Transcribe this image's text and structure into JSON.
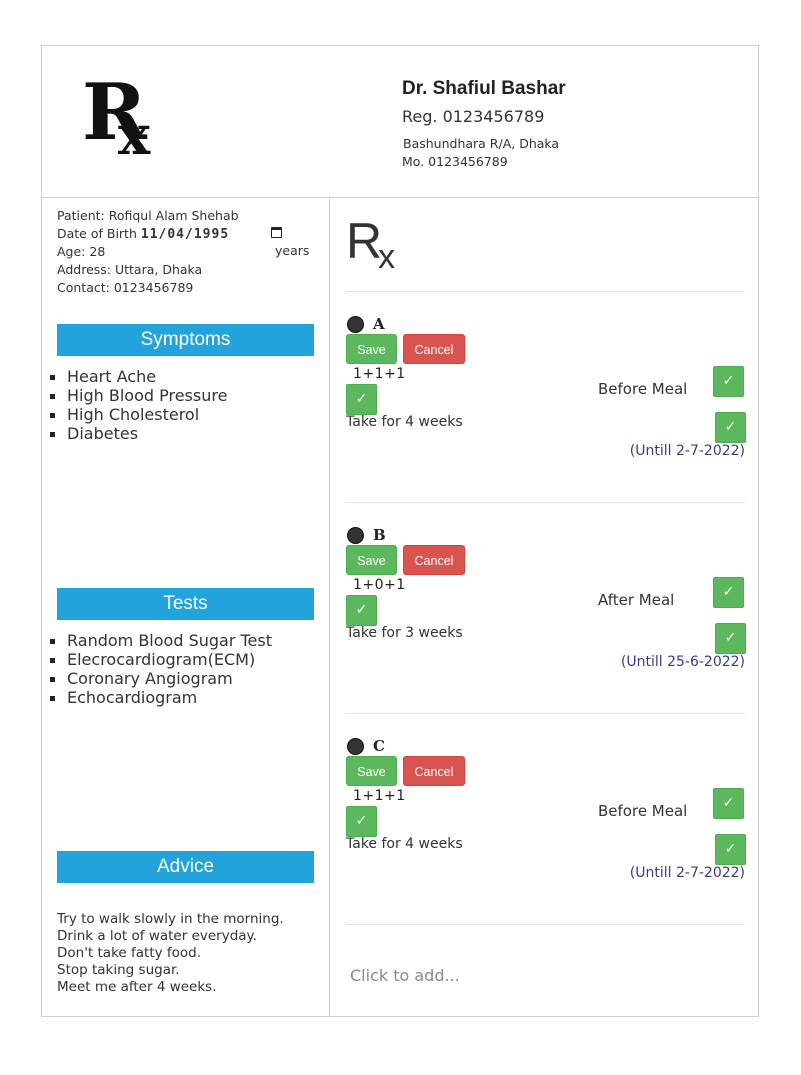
{
  "doctor": {
    "name": "Dr.  Shafiul Bashar",
    "reg": "Reg.  0123456789",
    "address": "Bashundhara R/A, Dhaka",
    "mobile": "Mo.  0123456789"
  },
  "logo": {
    "big": "R",
    "sub": "x"
  },
  "patient": {
    "name_line": "Patient:  Rofiqul Alam Shehab",
    "dob_label": "Date of Birth",
    "dob_value": "11/04/1995",
    "age_line": "Age:  28",
    "age_unit": "years",
    "address_line": "Address:  Uttara, Dhaka",
    "contact_line": "Contact:  0123456789"
  },
  "symptoms": {
    "title": "Symptoms",
    "items": [
      "Heart Ache",
      "High Blood Pressure",
      "High Cholesterol",
      "Diabetes"
    ]
  },
  "tests": {
    "title": "Tests",
    "items": [
      "Random Blood Sugar Test",
      "Elecrocardiogram(ECM)",
      "Coronary Angiogram",
      "Echocardiogram"
    ]
  },
  "advice": {
    "title": "Advice",
    "lines": [
      "Try to walk slowly in the morning.",
      "Drink a lot of water everyday.",
      "Don't take fatty food.",
      "Stop taking sugar.",
      "Meet me after 4 weeks."
    ]
  },
  "rx_heading": {
    "big": "R",
    "sub": "x"
  },
  "medicines": [
    {
      "name": "A",
      "save": "Save",
      "cancel": "Cancel",
      "dose": "1+1+1",
      "check": "✓",
      "duration": "Take for  4 weeks",
      "meal": "Before Meal",
      "until": "(Untill 2-7-2022)"
    },
    {
      "name": "B",
      "save": "Save",
      "cancel": "Cancel",
      "dose": "1+0+1",
      "check": "✓",
      "duration": "Take for  3 weeks",
      "meal": "After Meal",
      "until": "(Untill 25-6-2022)"
    },
    {
      "name": "C",
      "save": "Save",
      "cancel": "Cancel",
      "dose": "1+1+1",
      "check": "✓",
      "duration": "Take for  4 weeks",
      "meal": "Before Meal",
      "until": "(Untill 2-7-2022)"
    }
  ],
  "add_placeholder": "Click to add...",
  "colors": {
    "section_header": "#23a3dc",
    "save": "#5cb85c",
    "cancel": "#d9534f",
    "until_text": "#3a3a8c"
  }
}
